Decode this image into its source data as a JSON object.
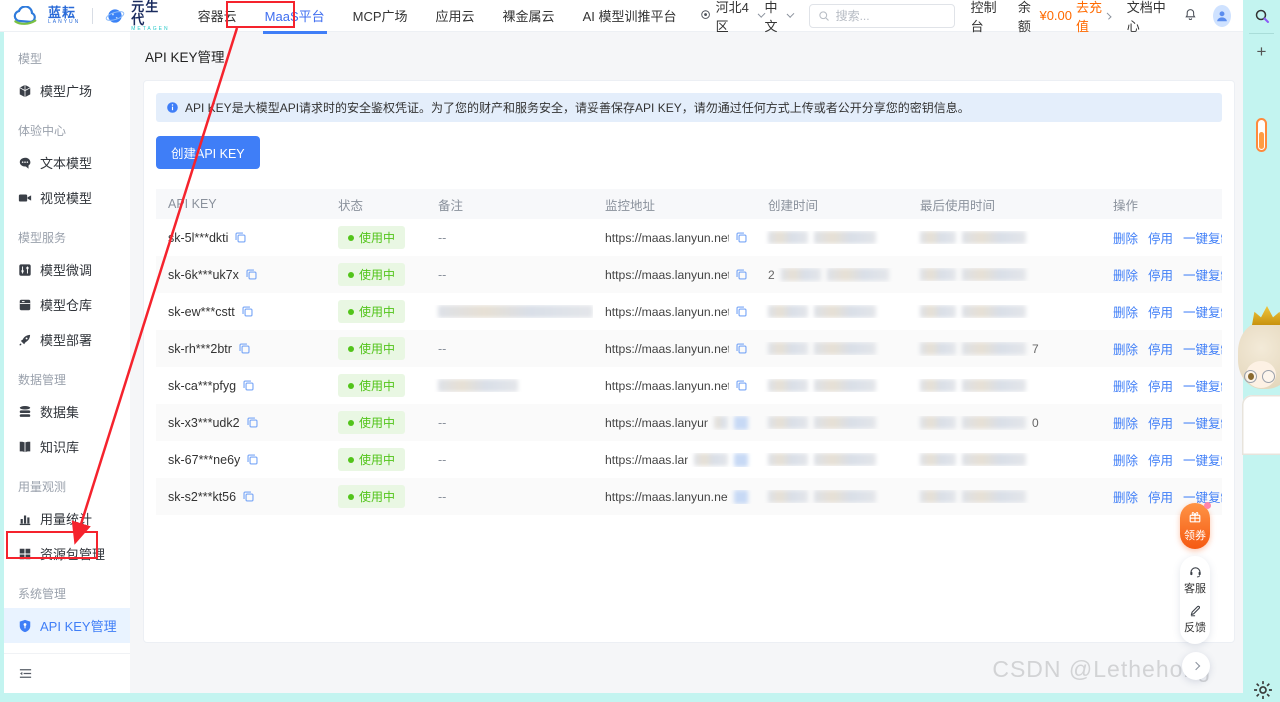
{
  "topnav": {
    "brand": {
      "name1": "蓝耘",
      "sub1": "LANYUN",
      "name2": "元生代",
      "sub2": "METAGEN"
    },
    "items": [
      {
        "label": "容器云",
        "active": false
      },
      {
        "label": "MaaS平台",
        "active": true
      },
      {
        "label": "MCP广场",
        "active": false
      },
      {
        "label": "应用云",
        "active": false
      },
      {
        "label": "裸金属云",
        "active": false
      },
      {
        "label": "AI 模型训推平台",
        "active": false
      }
    ],
    "region": "河北4区",
    "lang": "中文",
    "search_placeholder": "搜索...",
    "console": "控制台",
    "balance_label": "余额",
    "balance_value": "¥0.00",
    "recharge": "去充值",
    "docs": "文档中心"
  },
  "sidebar": {
    "sections": [
      {
        "header": "模型",
        "items": [
          {
            "icon": "cube-icon",
            "label": "模型广场",
            "active": false
          }
        ]
      },
      {
        "header": "体验中心",
        "items": [
          {
            "icon": "chat-icon",
            "label": "文本模型",
            "active": false
          },
          {
            "icon": "camera-icon",
            "label": "视觉模型",
            "active": false
          }
        ]
      },
      {
        "header": "模型服务",
        "items": [
          {
            "icon": "sliders-icon",
            "label": "模型微调",
            "active": false
          },
          {
            "icon": "repo-icon",
            "label": "模型仓库",
            "active": false
          },
          {
            "icon": "rocket-icon",
            "label": "模型部署",
            "active": false
          }
        ]
      },
      {
        "header": "数据管理",
        "items": [
          {
            "icon": "database-icon",
            "label": "数据集",
            "active": false
          },
          {
            "icon": "book-icon",
            "label": "知识库",
            "active": false
          }
        ]
      },
      {
        "header": "用量观测",
        "items": [
          {
            "icon": "bar-chart-icon",
            "label": "用量统计",
            "active": false
          },
          {
            "icon": "package-icon",
            "label": "资源包管理",
            "active": false
          }
        ]
      },
      {
        "header": "系统管理",
        "items": [
          {
            "icon": "shield-icon",
            "label": "API KEY管理",
            "active": true
          }
        ]
      }
    ]
  },
  "main": {
    "page_title": "API KEY管理",
    "banner": "API KEY是大模型API请求时的安全鉴权凭证。为了您的财产和服务安全，请妥善保存API KEY，请勿通过任何方式上传或者公开分享您的密钥信息。",
    "create_button": "创建API KEY",
    "table": {
      "columns": [
        "API KEY",
        "状态",
        "备注",
        "监控地址",
        "创建时间",
        "最后使用时间",
        "操作"
      ],
      "status_label": "使用中",
      "actions": [
        "删除",
        "停用",
        "一键复制"
      ],
      "rows": [
        {
          "key": "sk-5l***dkti",
          "remark": "--",
          "remark_blur": 0,
          "monitor": "https://maas.lanyun.net/#/s...",
          "monitor_tail_blur": 0,
          "monitor_icon_blur": false,
          "created_prefix": "",
          "lastused_suffix": ""
        },
        {
          "key": "sk-6k***uk7x",
          "remark": "--",
          "remark_blur": 0,
          "monitor": "https://maas.lanyun.net/#/s...",
          "monitor_tail_blur": 0,
          "monitor_icon_blur": false,
          "created_prefix": "2",
          "lastused_suffix": ""
        },
        {
          "key": "sk-ew***cstt",
          "remark": "",
          "remark_blur": 155,
          "monitor": "https://maas.lanyun.net/#/s...",
          "monitor_tail_blur": 0,
          "monitor_icon_blur": false,
          "created_prefix": "",
          "lastused_suffix": ""
        },
        {
          "key": "sk-rh***2btr",
          "remark": "--",
          "remark_blur": 0,
          "monitor": "https://maas.lanyun.net/#/s...",
          "monitor_tail_blur": 0,
          "monitor_icon_blur": false,
          "created_prefix": "",
          "lastused_suffix": "7"
        },
        {
          "key": "sk-ca***pfyg",
          "remark": "",
          "remark_blur": 80,
          "monitor": "https://maas.lanyun.net/#/s...",
          "monitor_tail_blur": 0,
          "monitor_icon_blur": false,
          "created_prefix": "",
          "lastused_suffix": ""
        },
        {
          "key": "sk-x3***udk2",
          "remark": "--",
          "remark_blur": 0,
          "monitor": "https://maas.lanyun.net/#",
          "monitor_tail_blur": 14,
          "monitor_icon_blur": true,
          "created_prefix": "",
          "lastused_suffix": "0"
        },
        {
          "key": "sk-67***ne6y",
          "remark": "--",
          "remark_blur": 0,
          "monitor": "https://maas.lanyun",
          "monitor_tail_blur": 34,
          "monitor_icon_blur": true,
          "created_prefix": "",
          "lastused_suffix": ""
        },
        {
          "key": "sk-s2***kt56",
          "remark": "--",
          "remark_blur": 0,
          "monitor": "https://maas.lanyun.net/#/s",
          "monitor_tail_blur": 0,
          "monitor_icon_blur": true,
          "created_prefix": "",
          "lastused_suffix": ""
        }
      ]
    }
  },
  "floating": {
    "coupon": "领券",
    "support": "客服",
    "feedback": "反馈"
  },
  "watermark": "CSDN @Lethehong",
  "colors": {
    "accent_blue": "#3f7ef7",
    "status_green": "#52c41a",
    "orange": "#ff6a00",
    "strip_cyan": "#c3f4f0",
    "annotation_red": "#f5232d"
  }
}
